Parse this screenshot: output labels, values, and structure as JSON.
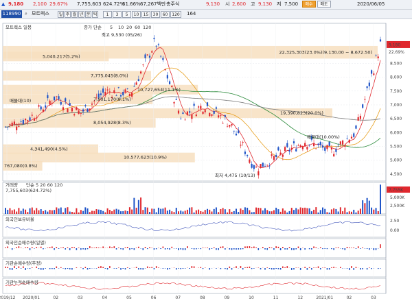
{
  "topbar": {
    "price": "9,180",
    "change": "2,100",
    "change_pct": "29.67%",
    "volume": "7,755,603",
    "volume_ratio": "624.72%",
    "ratio2": "61.66%",
    "market_cap": "67,267백만",
    "market_cap_label": "총주식",
    "field1": "9,130",
    "field1_label": "시",
    "field2": "2,600",
    "field2_label": "고",
    "field3": "9,130",
    "field3_label": "저",
    "field4": "7,500",
    "buy_label": "매수",
    "sell_label": "매도",
    "date": "2020/06/05",
    "value_164": "164",
    "interval_labels": [
      "1",
      "3",
      "5",
      "10",
      "15",
      "30",
      "60",
      "120"
    ],
    "price_red": "9,180"
  },
  "toolbar": {
    "code": "118990",
    "name": "모트렉스",
    "buttons": [
      "일",
      "주",
      "월",
      "년",
      "분",
      "틱"
    ]
  },
  "price_panel": {
    "legend": "모트렉스 일봉",
    "ma_legend_prefix": "종가 단순",
    "ma_periods": [
      "5",
      "10",
      "20",
      "60",
      "120"
    ],
    "price_marker": "9,180",
    "price_marker_pct": "22.69%",
    "y_ticks": [
      {
        "v": 8500,
        "label": "8,500"
      },
      {
        "v": 8000,
        "label": "8,000"
      },
      {
        "v": 7500,
        "label": "7,500"
      },
      {
        "v": 7000,
        "label": "7,000"
      },
      {
        "v": 6500,
        "label": "6,500"
      },
      {
        "v": 6000,
        "label": "6,000"
      },
      {
        "v": 5500,
        "label": "5,500"
      },
      {
        "v": 5000,
        "label": "5,000"
      },
      {
        "v": 4500,
        "label": "4,500"
      }
    ],
    "high_label": "최고 9,530 (05/26)",
    "low_label": "최저 4,475 (10/13)",
    "profile_labels": [
      {
        "text": "22,325,303(23.0%)(9,130.00 ~ 8,672.50)",
        "price": 8900
      },
      {
        "text": "5,040,217(5.2%)",
        "price": 8750
      },
      {
        "text": "7,775,045(8.0%)",
        "price": 8050
      },
      {
        "text": "10,727,654(11.1%)",
        "price": 7550
      },
      {
        "text": "7,901,170(8.1%)",
        "price": 7200
      },
      {
        "text": "19,390,823(20.0%)",
        "price": 6700
      },
      {
        "text": "8,054,928(8.3%)",
        "price": 6350
      },
      {
        "text": "4,341,490(4.5%)",
        "price": 5400
      },
      {
        "text": "10,577,623(10.9%)",
        "price": 5100
      },
      {
        "text": "767,080(0.8%)",
        "price": 4800
      }
    ],
    "annotations": [
      "매물대(10)",
      "매물대(10.00%)"
    ]
  },
  "volume_panel": {
    "legend": "거래량",
    "legend_ma": "단순 5 20 60 120",
    "value_text": "7,755,603(624.72%)",
    "y_ticks": [
      "5,000K",
      "2,500K"
    ],
    "marker": "7,755K"
  },
  "panel3": {
    "legend": "외국인보유비율",
    "y_ticks": [
      "2.50",
      "0.00"
    ]
  },
  "panel4": {
    "legend": "외국인순매수량(일별)",
    "y_ticks": [
      ""
    ]
  },
  "panel5": {
    "legend": "기관순매수량(추정)",
    "y_ticks": [
      ""
    ]
  },
  "panel6": {
    "legend": "기관누적순매수량",
    "y_ticks": [
      ""
    ]
  },
  "x_axis": {
    "labels": [
      "2019/12",
      "2020/01",
      "02",
      "03",
      "04",
      "05",
      "06",
      "07",
      "08",
      "09",
      "10",
      "11",
      "12",
      "2021/01",
      "02",
      "03"
    ]
  },
  "chart_data": {
    "type": "candlestick",
    "title": "",
    "xlabel": "",
    "ylabel": "",
    "ylim": [
      4300,
      9600
    ],
    "x": [
      "2019/12",
      "2020/01",
      "02",
      "03",
      "04",
      "05",
      "06",
      "07",
      "08",
      "09",
      "10",
      "11",
      "12",
      "2021/01",
      "02",
      "03"
    ],
    "series": [
      {
        "values": [
          6200,
          6550,
          7300,
          6700,
          7500,
          7400,
          9300,
          6600,
          7000,
          6300,
          4700,
          5200,
          5700,
          5300,
          6000,
          9180
        ]
      }
    ],
    "volume_profile": [
      {
        "price_range": [
          8672.5,
          9130
        ],
        "volume": 22325303,
        "pct": 23.0
      },
      {
        "price": 8750,
        "volume": 5040217,
        "pct": 5.2
      },
      {
        "price": 8050,
        "volume": 7775045,
        "pct": 8.0
      },
      {
        "price": 7550,
        "volume": 10727654,
        "pct": 11.1
      },
      {
        "price": 7200,
        "volume": 7901170,
        "pct": 8.1
      },
      {
        "price": 6700,
        "volume": 19390823,
        "pct": 20.0
      },
      {
        "price": 6350,
        "volume": 8054928,
        "pct": 8.3
      },
      {
        "price": 5400,
        "volume": 4341490,
        "pct": 4.5
      },
      {
        "price": 5100,
        "volume": 10577623,
        "pct": 10.9
      },
      {
        "price": 4800,
        "volume": 767080,
        "pct": 0.8
      }
    ],
    "high": {
      "price": 9530,
      "date": "05/26"
    },
    "low": {
      "price": 4475,
      "date": "10/13"
    },
    "last_volume": 7755603
  },
  "colors": {
    "up": "#e0282e",
    "down": "#1f54c8",
    "profile": "#f7dfc0",
    "ma5": "#e0282e",
    "ma20": "#e8a020",
    "ma60": "#2a8a3a",
    "ma120": "#7a7a7a"
  }
}
